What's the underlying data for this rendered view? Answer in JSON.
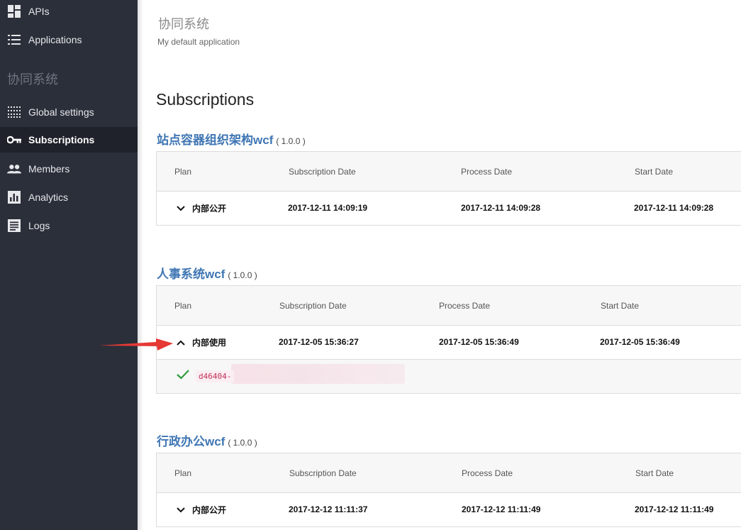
{
  "sidebar": {
    "items": [
      {
        "label": "APIs",
        "icon": "dashboard-icon"
      },
      {
        "label": "Applications",
        "icon": "list-icon"
      },
      {
        "label": "Global settings",
        "icon": "grid-dots-icon"
      },
      {
        "label": "Subscriptions",
        "icon": "key-icon"
      },
      {
        "label": "Members",
        "icon": "people-icon"
      },
      {
        "label": "Analytics",
        "icon": "bar-chart-icon"
      },
      {
        "label": "Logs",
        "icon": "document-icon"
      }
    ],
    "section_title": "协同系统",
    "active": "Subscriptions"
  },
  "header": {
    "app_name": "协同系统",
    "app_description": "My default application",
    "page_title": "Subscriptions"
  },
  "columns": [
    "Plan",
    "Subscription Date",
    "Process Date",
    "Start Date"
  ],
  "subscriptions": [
    {
      "api_name": "站点容器组织架构wcf",
      "version": "( 1.0.0 )",
      "plan": "内部公开",
      "subscription_date": "2017-12-11 14:09:19",
      "process_date": "2017-12-11 14:09:28",
      "start_date": "2017-12-11 14:09:28",
      "expanded": false
    },
    {
      "api_name": "人事系统wcf",
      "version": "( 1.0.0 )",
      "plan": "内部使用",
      "subscription_date": "2017-12-05 15:36:27",
      "process_date": "2017-12-05 15:36:49",
      "start_date": "2017-12-05 15:36:49",
      "expanded": true,
      "api_key": "d46404-"
    },
    {
      "api_name": "行政办公wcf",
      "version": "( 1.0.0 )",
      "plan": "内部公开",
      "subscription_date": "2017-12-12 11:11:37",
      "process_date": "2017-12-12 11:11:49",
      "start_date": "2017-12-12 11:11:49",
      "expanded": false
    }
  ],
  "colors": {
    "sidebar_bg": "#2b2f3a",
    "active_bg": "#1f222a",
    "api_link": "#3f76b3",
    "check_green": "#2e9a3a",
    "annotation_arrow": "#e53935"
  }
}
